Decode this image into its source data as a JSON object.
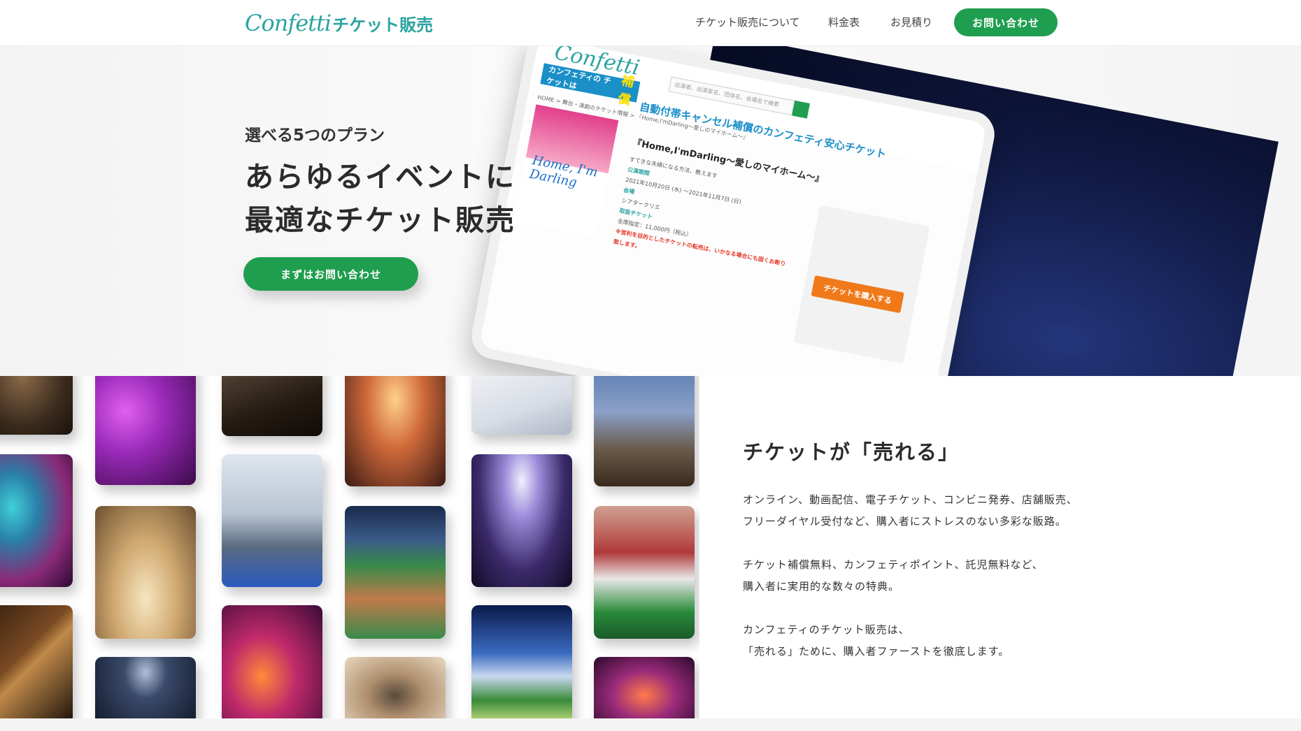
{
  "header": {
    "logo_word": "Confetti",
    "logo_ticket": "チケット販売",
    "nav": [
      "チケット販売について",
      "料金表",
      "お見積り"
    ],
    "cta": "お問い合わせ"
  },
  "hero": {
    "subtitle": "選べる5つのプラン",
    "title_line1": "あらゆるイベントに",
    "title_line2": "最適なチケット販売",
    "cta": "まずはお問い合わせ"
  },
  "mockup": {
    "logo": "Confetti",
    "badge_text": "カンフェティの チケットは",
    "badge_strong": "補償",
    "search_placeholder": "出演者、出演家名、団体名、会場名で検索",
    "headline": "自動付帯キャンセル補償のカンフェティ安心チケット",
    "breadcrumb": "HOME > 舞台・演劇のチケット情報 > 『Home,I'mDarling〜愛しのマイホーム〜』",
    "poster_title": "Home, I'm Darling",
    "event_name": "『Home,I'mDarling〜愛しのマイホーム〜』",
    "tagline": "すてきな夫婦になる方法、教えます",
    "period_label": "公演期間",
    "period": "2021年10月20日 (水) 〜2021年11月7日 (日)",
    "venue_label": "会場",
    "venue": "シアタークリエ",
    "price_label": "取扱チケット",
    "price": "全席指定：11,000円（税込）",
    "notice": "※営利を目的としたチケットの転売は、いかなる場合にも固くお断り致します。",
    "buy_button": "チケットを購入する"
  },
  "features": {
    "title": "チケットが「売れる」",
    "para1_line1": "オンライン、動画配信、電子チケット、コンビニ発券、店舗販売、",
    "para1_line2": "フリーダイヤル受付など、購入者にストレスのない多彩な販路。",
    "para2_line1": "チケット補償無料、カンフェティポイント、託児無料など、",
    "para2_line2": "購入者に実用的な数々の特典。",
    "para3_line1": "カンフェティのチケット販売は、",
    "para3_line2": "「売れる」ために、購入者ファーストを徹底します。"
  },
  "colors": {
    "brand_green": "#1f9e4f",
    "logo_teal": "#2aa4a0",
    "mock_blue": "#1a8fc8",
    "buy_orange": "#f07a1a"
  }
}
